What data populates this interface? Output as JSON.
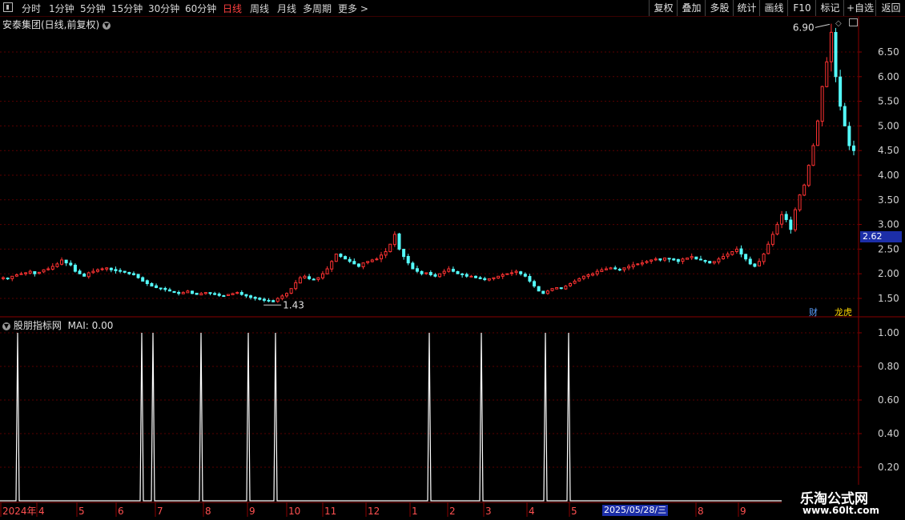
{
  "toolbar": {
    "periods": [
      "分时",
      "1分钟",
      "5分钟",
      "15分钟",
      "30分钟",
      "60分钟",
      "日线",
      "周线",
      "月线",
      "多周期",
      "更多 >"
    ],
    "active_period": "日线",
    "actions": [
      "复权",
      "叠加",
      "多股",
      "统计",
      "画线",
      "F10",
      "标记",
      "+自选",
      "返回"
    ]
  },
  "main_chart": {
    "title": "安泰集团(日线,前复权)",
    "y_ticks": [
      "6.50",
      "6.00",
      "5.50",
      "5.00",
      "4.50",
      "4.00",
      "3.50",
      "3.00",
      "2.50",
      "2.00",
      "1.50"
    ],
    "current_price": "2.62",
    "high_label": "6.90",
    "low_label": "1.43",
    "badges": {
      "financial": "财",
      "list": "龙虎"
    }
  },
  "indicator": {
    "title": "股朋指标网",
    "mai_label": "MAI: 0.00",
    "y_ticks": [
      "1.00",
      "0.80",
      "0.60",
      "0.40",
      "0.20"
    ]
  },
  "x_axis": {
    "labels": [
      "2024年",
      "4",
      "5",
      "6",
      "7",
      "8",
      "9",
      "10",
      "11",
      "12",
      "1",
      "2",
      "3",
      "4",
      "5",
      "8",
      "9"
    ],
    "cursor_date": "2025/05/28/三"
  },
  "watermark": {
    "title": "乐淘公式网",
    "url": "www.60lt.com"
  },
  "chart_data": {
    "type": "candlestick",
    "title": "安泰集团(日线,前复权)",
    "ylim": [
      1.2,
      7.0
    ],
    "close_series": [
      1.92,
      1.9,
      1.95,
      1.98,
      2.0,
      2.02,
      2.05,
      2.0,
      2.03,
      2.08,
      2.1,
      2.15,
      2.2,
      2.28,
      2.22,
      2.18,
      2.05,
      2.0,
      1.95,
      2.02,
      2.05,
      2.08,
      2.1,
      2.12,
      2.08,
      2.06,
      2.05,
      2.03,
      2.0,
      1.98,
      1.92,
      1.85,
      1.8,
      1.75,
      1.72,
      1.7,
      1.68,
      1.65,
      1.62,
      1.6,
      1.62,
      1.65,
      1.6,
      1.58,
      1.6,
      1.62,
      1.6,
      1.58,
      1.56,
      1.55,
      1.58,
      1.6,
      1.62,
      1.58,
      1.55,
      1.52,
      1.5,
      1.48,
      1.46,
      1.45,
      1.43,
      1.5,
      1.55,
      1.6,
      1.7,
      1.82,
      1.92,
      1.95,
      1.9,
      1.88,
      1.92,
      2.0,
      2.1,
      2.25,
      2.4,
      2.35,
      2.3,
      2.25,
      2.2,
      2.15,
      2.22,
      2.25,
      2.28,
      2.3,
      2.38,
      2.45,
      2.6,
      2.8,
      2.5,
      2.35,
      2.22,
      2.1,
      2.05,
      2.0,
      2.02,
      1.98,
      1.95,
      2.0,
      2.05,
      2.1,
      2.05,
      2.0,
      1.98,
      1.95,
      1.95,
      1.92,
      1.9,
      1.88,
      1.9,
      1.92,
      1.95,
      1.98,
      2.0,
      2.02,
      2.05,
      2.0,
      1.95,
      1.85,
      1.75,
      1.65,
      1.6,
      1.65,
      1.7,
      1.72,
      1.7,
      1.75,
      1.8,
      1.85,
      1.9,
      1.95,
      1.98,
      2.0,
      2.05,
      2.08,
      2.1,
      2.12,
      2.1,
      2.08,
      2.12,
      2.15,
      2.18,
      2.2,
      2.22,
      2.25,
      2.28,
      2.3,
      2.28,
      2.32,
      2.3,
      2.28,
      2.25,
      2.3,
      2.32,
      2.35,
      2.3,
      2.28,
      2.25,
      2.22,
      2.25,
      2.3,
      2.35,
      2.4,
      2.45,
      2.5,
      2.4,
      2.3,
      2.2,
      2.15,
      2.25,
      2.4,
      2.6,
      2.8,
      3.0,
      3.2,
      3.1,
      2.9,
      3.3,
      3.6,
      3.8,
      4.2,
      4.6,
      5.1,
      5.8,
      6.3,
      6.9,
      6.0,
      5.4,
      5.0,
      4.6,
      4.5
    ]
  }
}
